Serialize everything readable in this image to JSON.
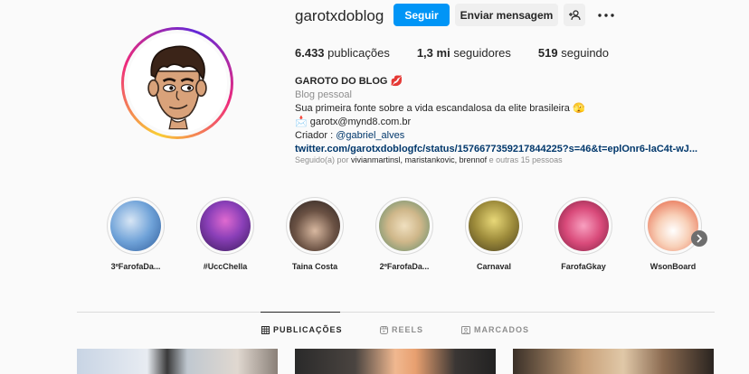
{
  "profile": {
    "username": "garotxdoblog",
    "follow_label": "Seguir",
    "message_label": "Enviar mensagem",
    "stats": {
      "posts_count": "6.433",
      "posts_label": "publicações",
      "followers_count": "1,3 mi",
      "followers_label": "seguidores",
      "following_count": "519",
      "following_label": "seguindo"
    },
    "bio": {
      "name": "GAROTO DO BLOG 💋",
      "category": "Blog pessoal",
      "line1": "Sua primeira fonte sobre a vida escandalosa da elite brasileira 🫣",
      "email": "📩 garotx@mynd8.com.br",
      "creator_prefix": "Criador : ",
      "creator_handle": "@gabriel_alves",
      "url": "twitter.com/garotxdoblogfc/status/1576677359217844225?s=46&t=eplOnr6-laC4t-wJ..."
    },
    "followed_by": {
      "prefix": "Seguido(a) por ",
      "names": "vivianmartinsl, maristankovic, brennof",
      "suffix": " e outras 15 pessoas"
    }
  },
  "highlights": [
    {
      "label": "3ºFarofaDa...",
      "color": "#6fa2d8"
    },
    {
      "label": "#UccChella",
      "color": "#8a3fb8"
    },
    {
      "label": "Taina Costa",
      "color": "#6b5244"
    },
    {
      "label": "2ºFarofaDa...",
      "color": "#cfb78a"
    },
    {
      "label": "Carnaval",
      "color": "#9c8a3a"
    },
    {
      "label": "FarofaGkay",
      "color": "#d94a7a"
    },
    {
      "label": "WsonBoard",
      "color": "#e45a3a"
    }
  ],
  "tabs": {
    "posts": "PUBLICAÇÕES",
    "reels": "REELS",
    "tagged": "MARCADOS"
  },
  "icons": {
    "add_user": "add-user-icon",
    "more": "more-icon",
    "grid": "grid-icon",
    "reels": "reels-icon",
    "tagged": "tagged-icon",
    "next": "chevron-right-icon"
  },
  "colors": {
    "accent": "#0095f6",
    "link": "#00376b",
    "muted": "#8e8e8e"
  }
}
